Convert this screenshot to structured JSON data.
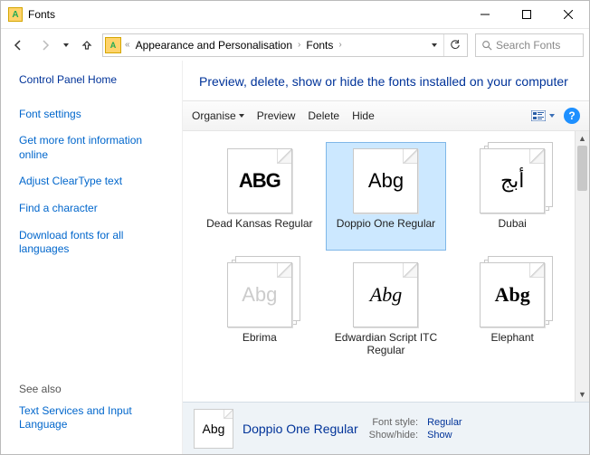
{
  "window": {
    "title": "Fonts"
  },
  "breadcrumb": {
    "part1": "Appearance and Personalisation",
    "part2": "Fonts"
  },
  "search": {
    "placeholder": "Search Fonts"
  },
  "sidebar": {
    "home": "Control Panel Home",
    "links": [
      "Font settings",
      "Get more font information online",
      "Adjust ClearType text",
      "Find a character",
      "Download fonts for all languages"
    ],
    "seealso_label": "See also",
    "seealso_links": [
      "Text Services and Input Language"
    ]
  },
  "heading": "Preview, delete, show or hide the fonts installed on your computer",
  "toolbar": {
    "organise": "Organise",
    "preview": "Preview",
    "delete": "Delete",
    "hide": "Hide"
  },
  "fonts": [
    {
      "name": "Dead Kansas Regular",
      "sample": "ABG",
      "multi": false,
      "sample_class": "sample-deadkansas",
      "selected": false
    },
    {
      "name": "Doppio One Regular",
      "sample": "Abg",
      "multi": false,
      "sample_class": "sample-doppio",
      "selected": true
    },
    {
      "name": "Dubai",
      "sample": "أبج",
      "multi": true,
      "sample_class": "sample-dubai",
      "selected": false
    },
    {
      "name": "Ebrima",
      "sample": "Abg",
      "multi": true,
      "sample_class": "sample-ebrima",
      "selected": false
    },
    {
      "name": "Edwardian Script ITC Regular",
      "sample": "Abg",
      "multi": false,
      "sample_class": "sample-edwardian",
      "selected": false
    },
    {
      "name": "Elephant",
      "sample": "Abg",
      "multi": true,
      "sample_class": "sample-elephant",
      "selected": false
    }
  ],
  "details": {
    "preview_sample": "Abg",
    "name": "Doppio One Regular",
    "fontstyle_label": "Font style:",
    "fontstyle_value": "Regular",
    "showhide_label": "Show/hide:",
    "showhide_value": "Show"
  }
}
